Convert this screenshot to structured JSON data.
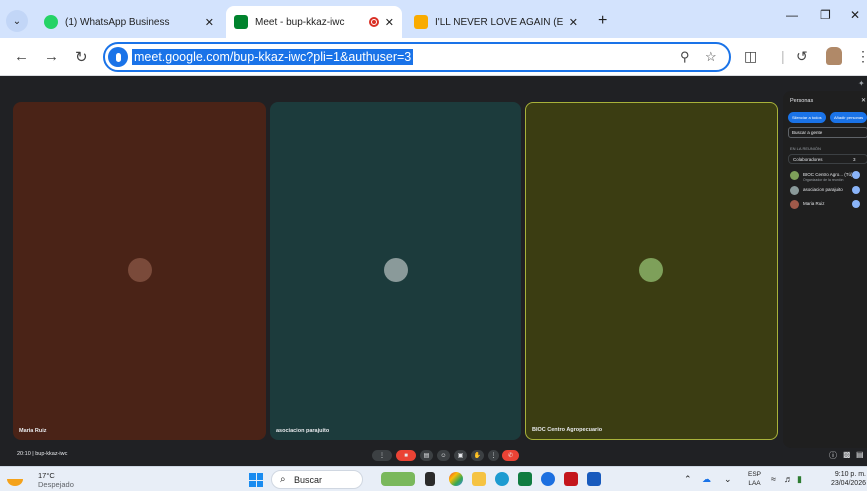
{
  "browser": {
    "tabs": [
      {
        "title": "(1) WhatsApp Business",
        "favicon": "whatsapp-icon",
        "favicon_color": "#25d366",
        "active": false
      },
      {
        "title": "Meet - bup-kkaz-iwc",
        "favicon": "google-meet-icon",
        "favicon_color": "#00832d",
        "active": true,
        "recording": true
      },
      {
        "title": "I'LL NEVER LOVE AGAIN (EN ESPAÑOL",
        "favicon": "generic-favicon-icon",
        "favicon_color": "#f9ab00",
        "active": false
      }
    ],
    "address": "meet.google.com/bup-kkaz-iwc?pli=1&authuser=3"
  },
  "meet": {
    "participants": [
      {
        "name": "Maria Ruiz",
        "tile_color": "#4a2317",
        "avatar_color": "#7a4a3a"
      },
      {
        "name": "asociacion parajuito",
        "tile_color": "#1c3b3c",
        "avatar_color": "#8a9a9a"
      },
      {
        "name": "BIOC Centro Agropecuario",
        "tile_color": "#3b3d12",
        "avatar_color": "#7ea05a",
        "active_speaker": true,
        "border_color": "#a8b23a"
      }
    ],
    "meeting_label": "20:10  |  bup-kkaz-iwc",
    "panel": {
      "title": "Personas",
      "buttons": [
        "Silenciar a todos",
        "Añadir personas"
      ],
      "search_placeholder": "Buscar a gente",
      "section": "EN LA REUNIÓN",
      "group_label": "Colaboradores",
      "group_count": "3",
      "people": [
        {
          "name": "BIOC Centro Agro... (Tú)",
          "sub": "Organizador de la reunión",
          "avatar_color": "#7ea05a"
        },
        {
          "name": "asociacion parajuito",
          "sub": "",
          "avatar_color": "#8a9a9a"
        },
        {
          "name": "Maria Ruiz",
          "sub": "",
          "avatar_color": "#a05a4a"
        }
      ]
    }
  },
  "taskbar": {
    "weather_temp": "17°C",
    "weather_condition": "Despejado",
    "search_label": "Buscar",
    "lang_line1": "ESP",
    "lang_line2": "LAA",
    "time": "9:10 p. m.",
    "date": "23/04/2026"
  }
}
